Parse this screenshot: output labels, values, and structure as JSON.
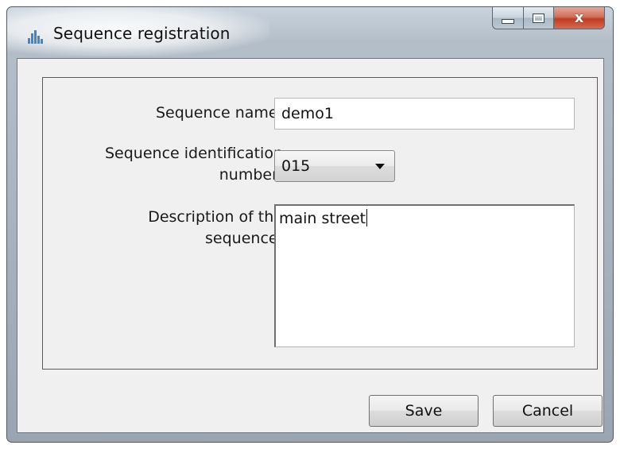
{
  "window": {
    "title": "Sequence registration",
    "app_icon": "bar-chart-icon",
    "controls": {
      "minimize_icon": "minimize-icon",
      "maximize_icon": "maximize-icon",
      "close_icon": "close-icon",
      "close_glyph": "x"
    }
  },
  "form": {
    "name_label": "Sequence name:",
    "name_value": "demo1",
    "id_label_line1": "Sequence identification",
    "id_label_line2": "number:",
    "id_selected": "015",
    "description_label_line1": "Description of the",
    "description_label_line2": "sequence:",
    "description_value": "main street"
  },
  "buttons": {
    "save_label": "Save",
    "cancel_label": "Cancel"
  },
  "colors": {
    "close_button": "#c8452c",
    "icon_blue": "#3f86cf"
  }
}
